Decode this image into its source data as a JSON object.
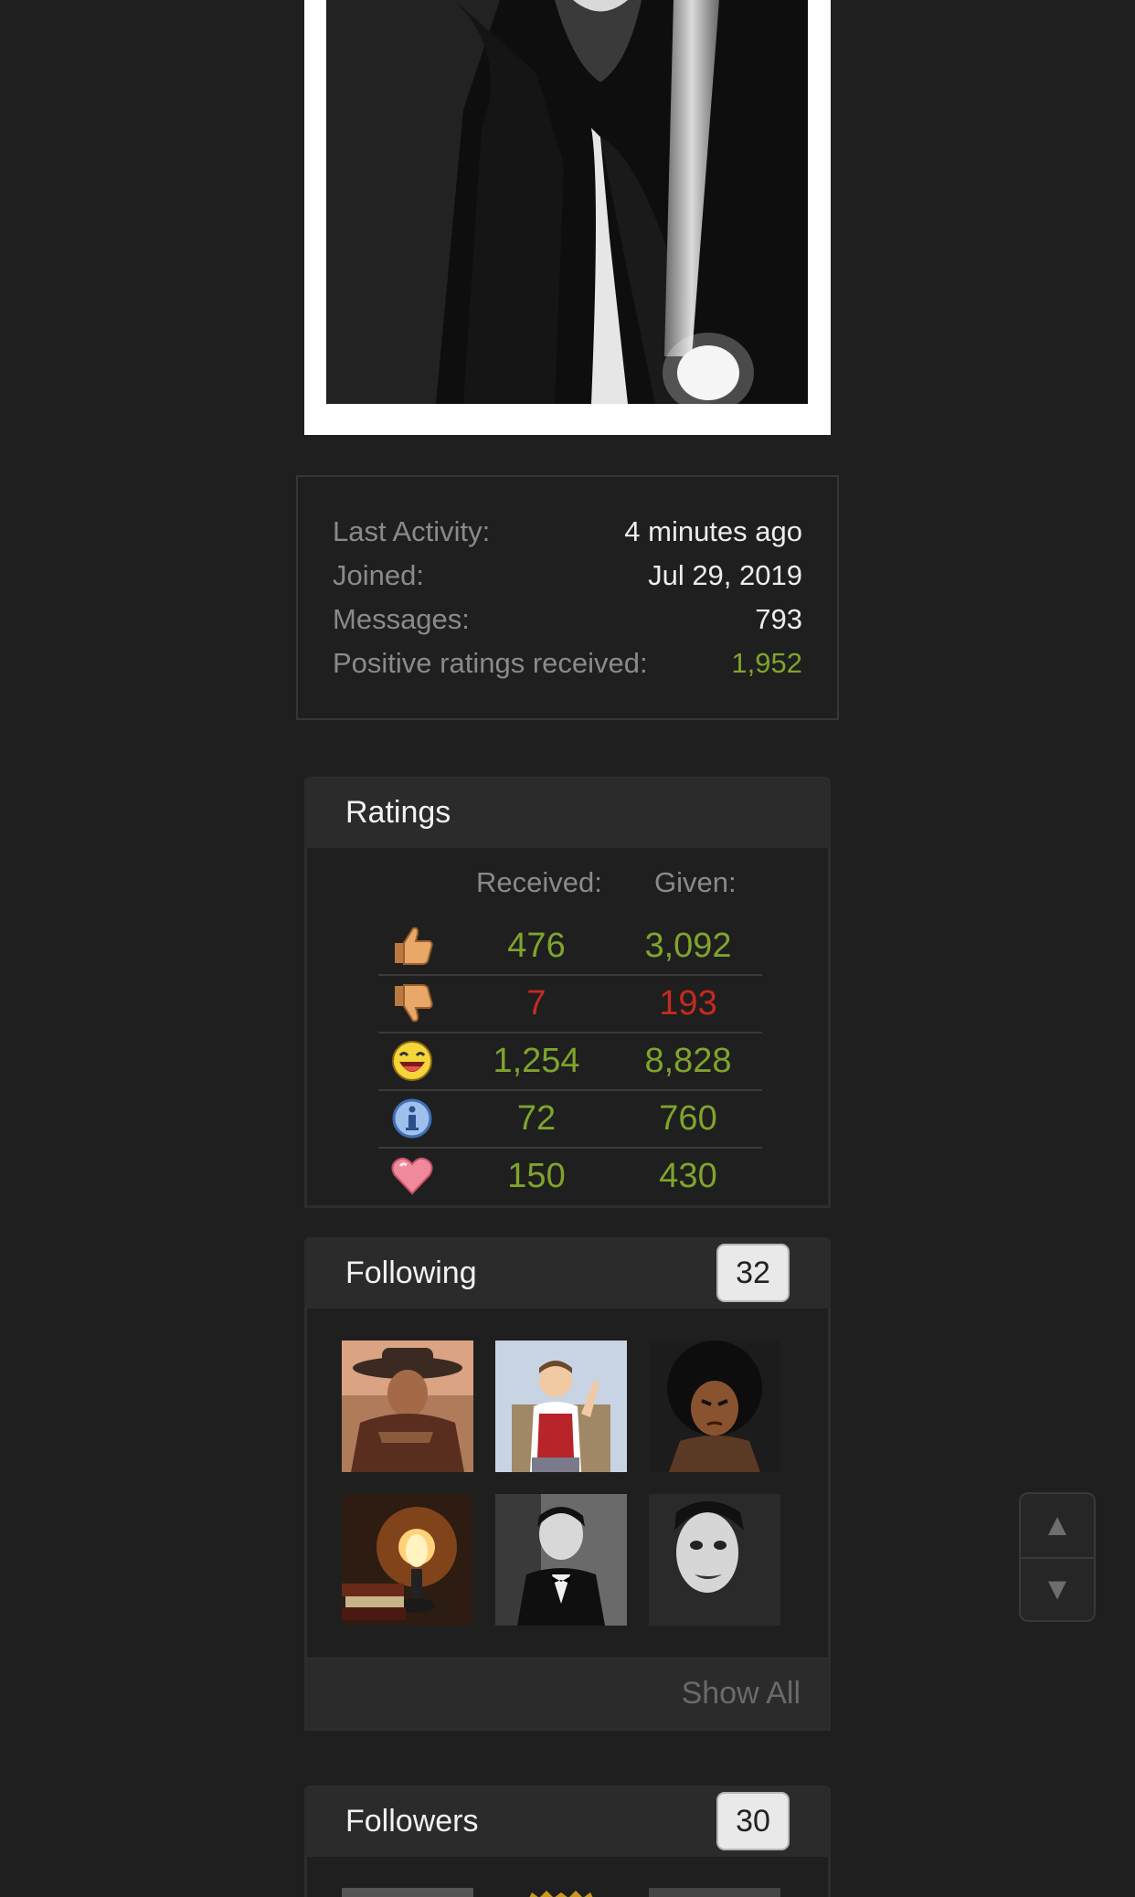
{
  "profile_stats": {
    "rows": [
      {
        "label": "Last Activity:",
        "value": "4 minutes ago"
      },
      {
        "label": "Joined:",
        "value": "Jul 29, 2019"
      },
      {
        "label": "Messages:",
        "value": "793"
      },
      {
        "label": "Positive ratings received:",
        "value": "1,952"
      }
    ],
    "highlight_color": "#7fa42c"
  },
  "ratings": {
    "title": "Ratings",
    "received_header": "Received:",
    "given_header": "Given:",
    "rows": [
      {
        "icon": "thumbs-up-icon",
        "received": "476",
        "given": "3,092",
        "tone": "positive"
      },
      {
        "icon": "thumbs-down-icon",
        "received": "7",
        "given": "193",
        "tone": "negative"
      },
      {
        "icon": "laughing-face-icon",
        "received": "1,254",
        "given": "8,828",
        "tone": "positive"
      },
      {
        "icon": "info-icon",
        "received": "72",
        "given": "760",
        "tone": "positive"
      },
      {
        "icon": "heart-icon",
        "received": "150",
        "given": "430",
        "tone": "positive"
      }
    ],
    "colors": {
      "positive": "#7fa42c",
      "negative": "#c42b1f"
    }
  },
  "following": {
    "title": "Following",
    "count": "32",
    "show_all_label": "Show All",
    "avatars": [
      "cowboy-avatar",
      "cartoon-man-avatar",
      "afro-cartoon-avatar",
      "lamp-books-avatar",
      "tuxedo-man-avatar",
      "white-face-avatar"
    ]
  },
  "followers": {
    "title": "Followers",
    "count": "30"
  },
  "scroll_controls": {
    "up_glyph": "▲",
    "down_glyph": "▼"
  }
}
